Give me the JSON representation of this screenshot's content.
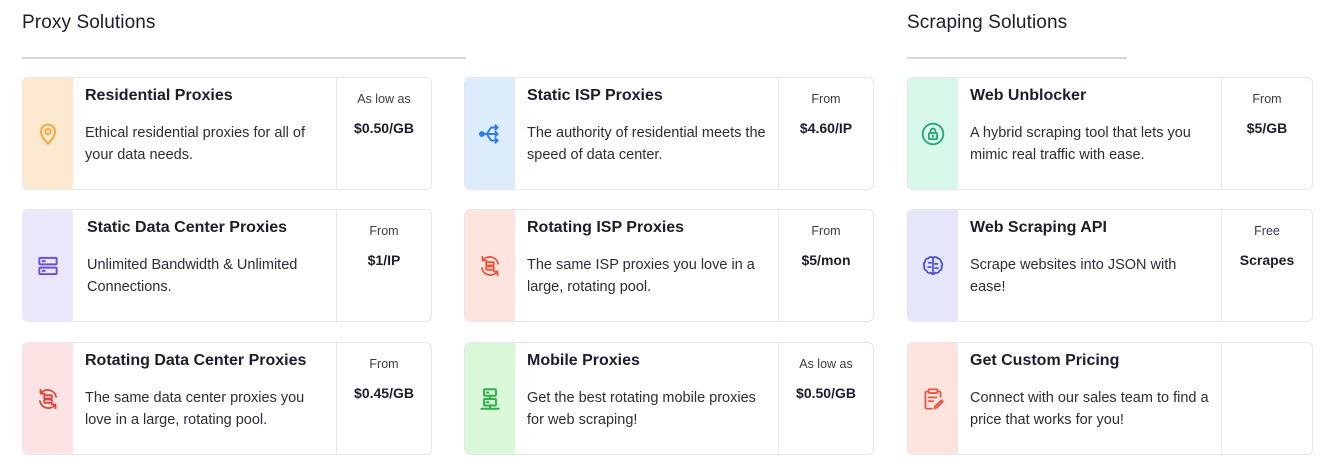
{
  "sections": {
    "proxy": {
      "title": "Proxy Solutions"
    },
    "scraping": {
      "title": "Scraping Solutions"
    }
  },
  "cards": {
    "residential": {
      "icon": "location-pin-icon",
      "accent": "#f3a83b",
      "title": "Residential Proxies",
      "desc": "Ethical residential proxies for all of your data needs.",
      "lead": "As low as",
      "amount": "$0.50/GB"
    },
    "static_dc": {
      "icon": "server-stack-icon",
      "accent": "#6a4fd8",
      "title": "Static Data Center Proxies",
      "desc": "Unlimited Bandwidth & Unlimited Connections.",
      "lead": "From",
      "amount": "$1/IP"
    },
    "rotating_dc": {
      "icon": "rotating-server-icon",
      "accent": "#d9463e",
      "title": "Rotating Data Center Proxies",
      "desc": "The same data center proxies you love in a large, rotating pool.",
      "lead": "From",
      "amount": "$0.45/GB"
    },
    "static_isp": {
      "icon": "split-arrows-icon",
      "accent": "#2f7de1",
      "title": "Static ISP Proxies",
      "desc": "The authority of residential meets the speed of data center.",
      "lead": "From",
      "amount": "$4.60/IP"
    },
    "rotating_isp": {
      "icon": "rotating-server-icon",
      "accent": "#e8573f",
      "title": "Rotating ISP Proxies",
      "desc": "The same ISP proxies you love in a large, rotating pool.",
      "lead": "From",
      "amount": "$5/mon"
    },
    "mobile": {
      "icon": "mobile-network-icon",
      "accent": "#2eae4a",
      "title": "Mobile Proxies",
      "desc": "Get the best rotating mobile proxies for web scraping!",
      "lead": "As low as",
      "amount": "$0.50/GB"
    },
    "web_unblocker": {
      "icon": "unlock-icon",
      "accent": "#27a57a",
      "title": "Web Unblocker",
      "desc": "A hybrid scraping tool that lets you mimic real traffic with ease.",
      "lead": "From",
      "amount": "$5/GB"
    },
    "scraping_api": {
      "icon": "brain-chip-icon",
      "accent": "#4b4fd6",
      "title": "Web Scraping API",
      "desc": "Scrape websites into JSON with ease!",
      "lead": "Free",
      "amount": "Scrapes"
    },
    "custom_pricing": {
      "icon": "clipboard-edit-icon",
      "accent": "#e8573f",
      "title": "Get Custom Pricing",
      "desc": "Connect with our sales team to find a price that works for you!",
      "lead": "",
      "amount": ""
    }
  }
}
